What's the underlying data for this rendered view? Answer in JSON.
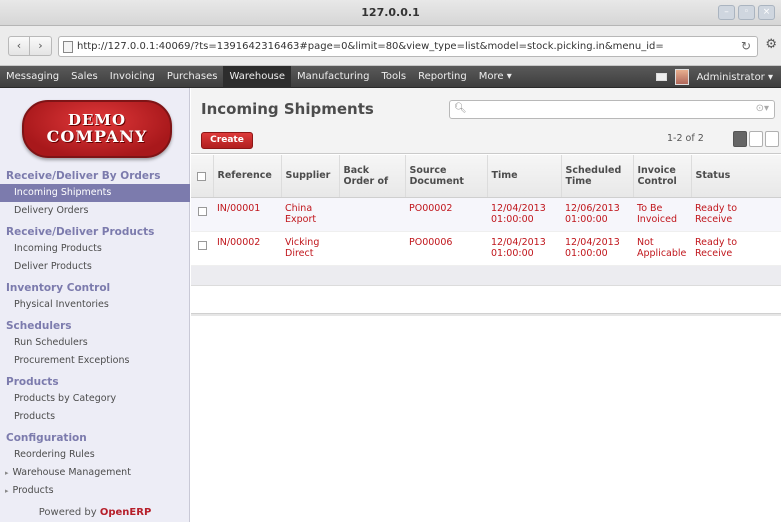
{
  "window": {
    "title": "127.0.0.1",
    "buttons": [
      "–",
      "◦",
      "×"
    ]
  },
  "browser": {
    "back_icon": "back-arrow",
    "forward_icon": "forward-arrow",
    "url": "http://127.0.0.1:40069/?ts=1391642316463#page=0&limit=80&view_type=list&model=stock.picking.in&menu_id=",
    "reload_icon": "reload-icon",
    "settings_icon": "gear-icon"
  },
  "topmenu": {
    "items": [
      "Messaging",
      "Sales",
      "Invoicing",
      "Purchases",
      "Warehouse",
      "Manufacturing",
      "Tools",
      "Reporting",
      "More ▾"
    ],
    "active": "Warehouse",
    "user": "Administrator ▾"
  },
  "logo": {
    "line1": "DEMO",
    "line2": "COMPANY"
  },
  "sidebar": {
    "sections": [
      {
        "title": "Receive/Deliver By Orders",
        "items": [
          "Incoming Shipments",
          "Delivery Orders"
        ]
      },
      {
        "title": "Receive/Deliver Products",
        "items": [
          "Incoming Products",
          "Deliver Products"
        ]
      },
      {
        "title": "Inventory Control",
        "items": [
          "Physical Inventories"
        ]
      },
      {
        "title": "Schedulers",
        "items": [
          "Run Schedulers",
          "Procurement Exceptions"
        ]
      },
      {
        "title": "Products",
        "items": [
          "Products by Category",
          "Products"
        ]
      },
      {
        "title": "Configuration",
        "items": [
          "Reordering Rules",
          "Warehouse Management",
          "Products"
        ]
      }
    ],
    "active_item": "Incoming Shipments",
    "powered_prefix": "Powered by ",
    "powered_brand": "OpenERP"
  },
  "main": {
    "title": "Incoming Shipments",
    "search_placeholder": "",
    "search_options": "⊙▾",
    "create_label": "Create",
    "pager": "1-2 of 2",
    "columns": [
      "Reference",
      "Supplier",
      "Back Order of",
      "Source Document",
      "Time",
      "Scheduled Time",
      "Invoice Control",
      "Status"
    ],
    "rows": [
      {
        "reference": "IN/00001",
        "supplier": "China Export",
        "back_order": "",
        "source": "PO00002",
        "time": "12/04/2013 01:00:00",
        "scheduled": "12/06/2013 01:00:00",
        "invoice": "To Be Invoiced",
        "status": "Ready to Receive"
      },
      {
        "reference": "IN/00002",
        "supplier": "Vicking Direct",
        "back_order": "",
        "source": "PO00006",
        "time": "12/04/2013 01:00:00",
        "scheduled": "12/04/2013 01:00:00",
        "invoice": "Not Applicable",
        "status": "Ready to Receive"
      }
    ]
  },
  "colors": {
    "accent": "#7c7bad",
    "row_text": "#c0161c",
    "create_button": "#c42a2a",
    "topmenu_bg": "#4a4a4a"
  }
}
